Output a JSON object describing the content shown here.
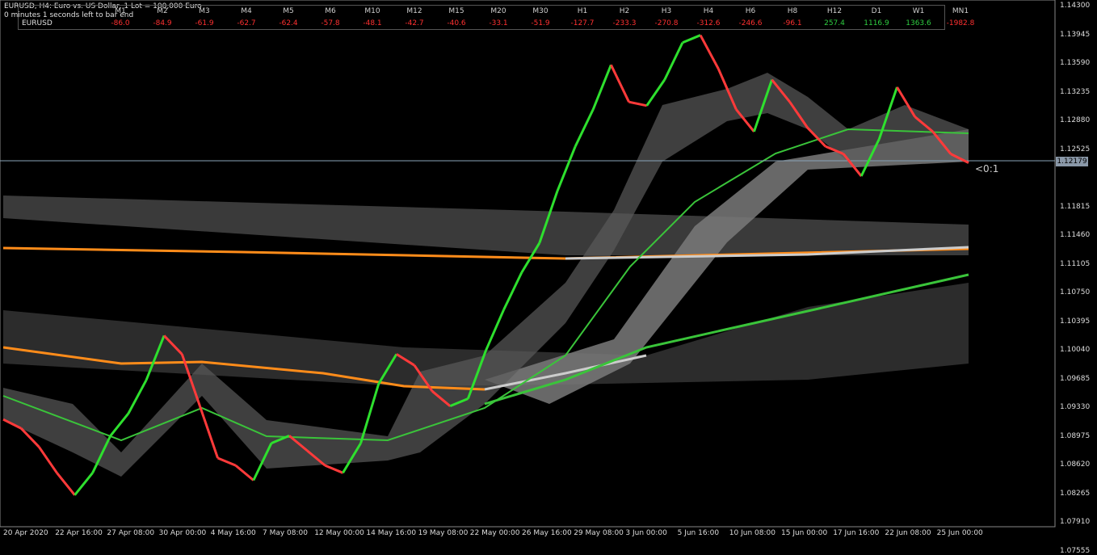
{
  "window": {
    "symbol_line": "EURUSD, H4:  Euro vs. US Dollar, 1 Lot = 100,000 Euro",
    "timer_line": "0 minutes 1 seconds left to bar end"
  },
  "strength_table": {
    "symbol": "EURUSD",
    "columns": [
      {
        "tf": "M1",
        "val": "-86.0",
        "color": "#ff3030"
      },
      {
        "tf": "M2",
        "val": "-84.9",
        "color": "#ff3030"
      },
      {
        "tf": "M3",
        "val": "-61.9",
        "color": "#ff3030"
      },
      {
        "tf": "M4",
        "val": "-62.7",
        "color": "#ff3030"
      },
      {
        "tf": "M5",
        "val": "-62.4",
        "color": "#ff3030"
      },
      {
        "tf": "M6",
        "val": "-57.8",
        "color": "#ff3030"
      },
      {
        "tf": "M10",
        "val": "-48.1",
        "color": "#ff3030"
      },
      {
        "tf": "M12",
        "val": "-42.7",
        "color": "#ff3030"
      },
      {
        "tf": "M15",
        "val": "-40.6",
        "color": "#ff3030"
      },
      {
        "tf": "M20",
        "val": "-33.1",
        "color": "#ff3030"
      },
      {
        "tf": "M30",
        "val": "-51.9",
        "color": "#ff3030"
      },
      {
        "tf": "H1",
        "val": "-127.7",
        "color": "#ff3030"
      },
      {
        "tf": "H2",
        "val": "-233.3",
        "color": "#ff3030"
      },
      {
        "tf": "H3",
        "val": "-270.8",
        "color": "#ff3030"
      },
      {
        "tf": "H4",
        "val": "-312.6",
        "color": "#ff3030"
      },
      {
        "tf": "H6",
        "val": "-246.6",
        "color": "#ff3030"
      },
      {
        "tf": "H8",
        "val": "-96.1",
        "color": "#ff3030"
      },
      {
        "tf": "H12",
        "val": "257.4",
        "color": "#2ecc40"
      },
      {
        "tf": "D1",
        "val": "1116.9",
        "color": "#2ecc40"
      },
      {
        "tf": "W1",
        "val": "1363.6",
        "color": "#2ecc40"
      },
      {
        "tf": "MN1",
        "val": "-1982.8",
        "color": "#ff3030"
      }
    ]
  },
  "price_axis": [
    "1.14300",
    "1.13945",
    "1.13590",
    "1.13235",
    "1.12880",
    "1.12525",
    "1.11815",
    "1.11460",
    "1.11105",
    "1.10750",
    "1.10395",
    "1.10040",
    "1.09685",
    "1.09330",
    "1.08975",
    "1.08620",
    "1.08265",
    "1.07910",
    "1.07555"
  ],
  "current_price": "1.12179",
  "countdown": "<0:1",
  "time_axis": [
    "20 Apr 2020",
    "22 Apr 16:00",
    "27 Apr 08:00",
    "30 Apr 00:00",
    "4 May 16:00",
    "7 May 08:00",
    "12 May 00:00",
    "14 May 16:00",
    "19 May 08:00",
    "22 May 00:00",
    "26 May 16:00",
    "29 May 08:00",
    "3 Jun 00:00",
    "5 Jun 16:00",
    "10 Jun 08:00",
    "15 Jun 00:00",
    "17 Jun 16:00",
    "22 Jun 08:00",
    "25 Jun 00:00"
  ],
  "chart_data": {
    "type": "line",
    "symbol": "EURUSD",
    "timeframe": "H4",
    "ylim": [
      1.0735,
      1.1432
    ],
    "series": [
      {
        "values": [
          1.0872,
          1.086,
          1.0835,
          1.08,
          1.077,
          1.08,
          1.085,
          1.088,
          1.0925,
          1.0985,
          1.096,
          1.089,
          1.082,
          1.081,
          1.079,
          1.084,
          1.085,
          1.083,
          1.081,
          1.08,
          1.084,
          1.092,
          1.096,
          1.0945,
          1.091,
          1.089,
          1.09,
          1.0965,
          1.102,
          1.107,
          1.111,
          1.118,
          1.124,
          1.129,
          1.135,
          1.13,
          1.1295,
          1.133,
          1.138,
          1.139,
          1.1345,
          1.129,
          1.126,
          1.133,
          1.13,
          1.1265,
          1.124,
          1.123,
          1.12,
          1.125,
          1.132,
          1.128,
          1.126,
          1.123,
          1.1218
        ]
      }
    ]
  }
}
